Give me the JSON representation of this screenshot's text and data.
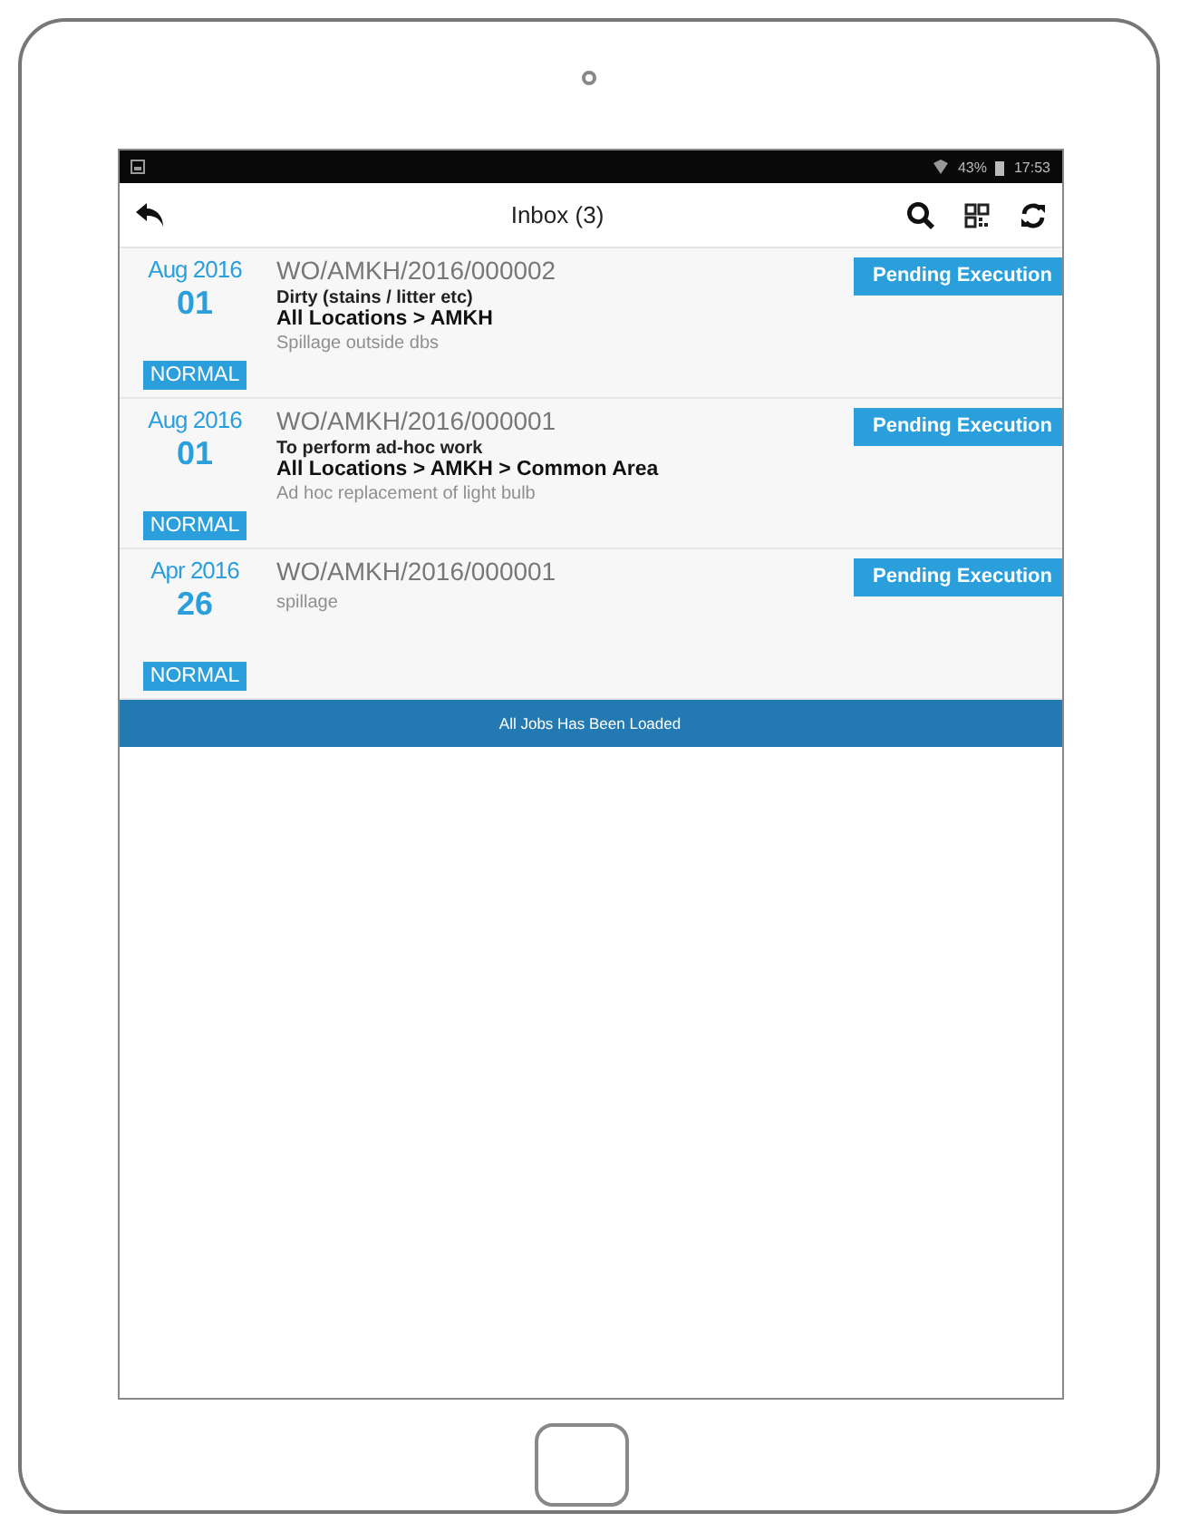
{
  "status_bar": {
    "battery": "43%",
    "time": "17:53"
  },
  "app_bar": {
    "title": "Inbox (3)"
  },
  "jobs": [
    {
      "month": "Aug 2016",
      "day": "01",
      "priority": "NORMAL",
      "number": "WO/AMKH/2016/000002",
      "status": "Pending Execution",
      "details": [
        {
          "kind": "category",
          "text": "Dirty (stains / litter etc)"
        },
        {
          "kind": "location",
          "text": "All Locations > AMKH"
        },
        {
          "kind": "description",
          "text": "Spillage outside dbs"
        }
      ]
    },
    {
      "month": "Aug 2016",
      "day": "01",
      "priority": "NORMAL",
      "number": "WO/AMKH/2016/000001",
      "status": "Pending Execution",
      "details": [
        {
          "kind": "category",
          "text": "To perform ad-hoc work"
        },
        {
          "kind": "location",
          "text": "All Locations > AMKH > Common Area"
        },
        {
          "kind": "description",
          "text": "Ad hoc replacement of light bulb"
        }
      ]
    },
    {
      "month": "Apr 2016",
      "day": "26",
      "priority": "NORMAL",
      "number": "WO/AMKH/2016/000001",
      "status": "Pending Execution",
      "details": [
        {
          "kind": "description",
          "text": "spillage"
        }
      ]
    }
  ],
  "footer_message": "All Jobs Has Been Loaded"
}
